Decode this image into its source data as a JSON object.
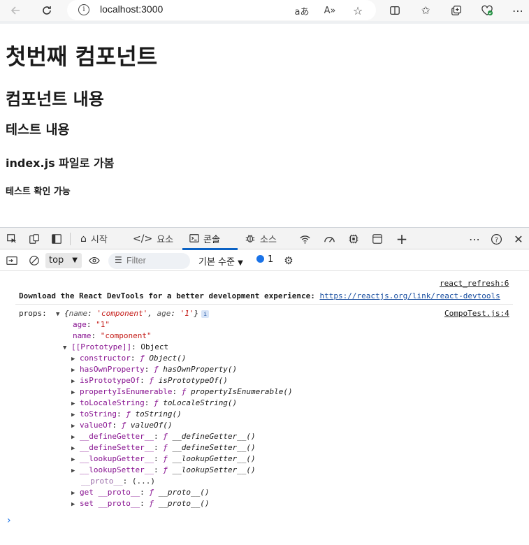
{
  "browser": {
    "url": "localhost:3000",
    "back_icon": "arrow-left",
    "refresh_icon": "refresh",
    "read_aloud_glyph": "aあ",
    "aa_glyph": "A»"
  },
  "page": {
    "h1": "첫번째 컴포넌트",
    "h2": "컴포넌트 내용",
    "h3": "테스트 내용",
    "h4": "index.js 파일로 가봄",
    "h5": "테스트 확인 가능"
  },
  "devtools": {
    "tabs": [
      {
        "label": "시작",
        "icon": "home"
      },
      {
        "label": "요소",
        "icon": "code"
      },
      {
        "label": "콘솔",
        "icon": "console",
        "active": true
      },
      {
        "label": "소스",
        "icon": "bug"
      }
    ],
    "context": "top",
    "filter_placeholder": "Filter",
    "levels_label": "기본 수준",
    "issues_count": "1"
  },
  "console": {
    "refresh_source": "react_refresh:6",
    "devtools_msg": "Download the React DevTools for a better development experience: ",
    "devtools_url": "https://reactjs.org/link/react-devtools",
    "props_label": "props:",
    "props_source": "CompoTest.js:4",
    "props_summary_open": "{",
    "props_summary_name_key": "name",
    "props_summary_name_val": "'component'",
    "props_summary_age_key": "age",
    "props_summary_age_val": "'1'",
    "props_summary_close": "}",
    "age_key": "age",
    "age_val": "\"1\"",
    "name_key": "name",
    "name_val": "\"component\"",
    "prototype_label": "[[Prototype]]",
    "prototype_val": "Object",
    "proto_items": [
      {
        "key": "constructor",
        "fn": "Object()"
      },
      {
        "key": "hasOwnProperty",
        "fn": "hasOwnProperty()"
      },
      {
        "key": "isPrototypeOf",
        "fn": "isPrototypeOf()"
      },
      {
        "key": "propertyIsEnumerable",
        "fn": "propertyIsEnumerable()"
      },
      {
        "key": "toLocaleString",
        "fn": "toLocaleString()"
      },
      {
        "key": "toString",
        "fn": "toString()"
      },
      {
        "key": "valueOf",
        "fn": "valueOf()"
      },
      {
        "key": "__defineGetter__",
        "fn": "__defineGetter__()"
      },
      {
        "key": "__defineSetter__",
        "fn": "__defineSetter__()"
      },
      {
        "key": "__lookupGetter__",
        "fn": "__lookupGetter__()"
      },
      {
        "key": "__lookupSetter__",
        "fn": "__lookupSetter__()"
      }
    ],
    "proto_accessor": "__proto__",
    "proto_accessor_val": "(...)",
    "get_proto": {
      "key": "get __proto__",
      "fn": "__proto__()"
    },
    "set_proto": {
      "key": "set __proto__",
      "fn": "__proto__()"
    }
  }
}
